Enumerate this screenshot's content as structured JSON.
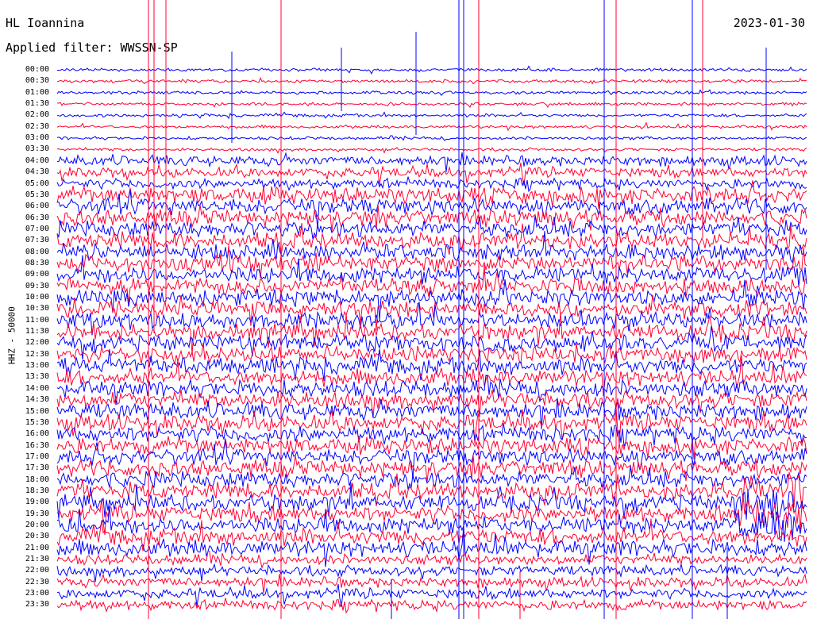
{
  "header": {
    "station": "HL Ioannina",
    "date": "2023-01-30",
    "filter": "Applied filter: WWSSN-SP"
  },
  "channel_label": "HHZ - 50000",
  "time_labels": [
    "00:00",
    "00:30",
    "01:00",
    "01:30",
    "02:00",
    "02:30",
    "03:00",
    "03:30",
    "04:00",
    "04:30",
    "05:00",
    "05:30",
    "06:00",
    "06:30",
    "07:00",
    "07:30",
    "08:00",
    "08:30",
    "09:00",
    "09:30",
    "10:00",
    "10:30",
    "11:00",
    "11:30",
    "12:00",
    "12:30",
    "13:00",
    "13:30",
    "14:00",
    "14:30",
    "15:00",
    "15:30",
    "16:00",
    "16:30",
    "17:00",
    "17:30",
    "18:00",
    "18:30",
    "19:00",
    "19:30",
    "20:00",
    "20:30",
    "21:00",
    "21:30",
    "22:00",
    "22:30",
    "23:00",
    "23:30"
  ],
  "colors": {
    "even": "#0000ff",
    "odd": "#ff0033"
  }
}
